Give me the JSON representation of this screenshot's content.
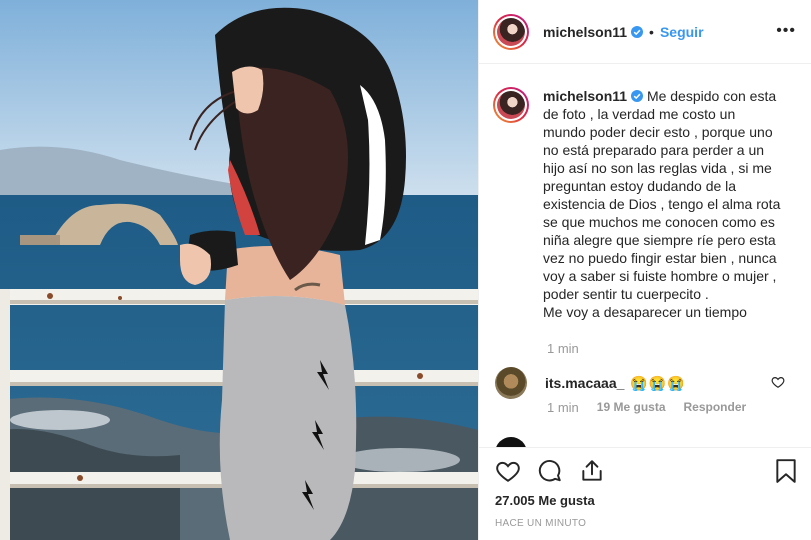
{
  "post": {
    "username": "michelson11",
    "follow_label": "Seguir",
    "more_label": "•••",
    "separator": "•"
  },
  "caption": {
    "username": "michelson11",
    "text_lines": [
      "Me despido con esta",
      "de foto , la verdad me costo un",
      "mundo poder decir esto , porque uno",
      "no está preparado para perder a un",
      "hijo así no son las reglas vida , si me",
      "preguntan estoy dudando de la",
      "existencia de Dios , tengo el alma rota",
      "se que muchos me conocen como es",
      "niña alegre que siempre ríe pero esta",
      "vez no puedo fingir estar bien , nunca",
      "voy a saber si fuiste hombre o mujer ,",
      "poder sentir tu cuerpecito .",
      "Me voy a desaparecer un tiempo"
    ],
    "time": "1 min"
  },
  "comment": {
    "username": "its.macaaa_",
    "text": "😭😭😭",
    "time": "1 min",
    "likes": "19 Me gusta",
    "reply_label": "Responder"
  },
  "footer": {
    "likes": "27.005 Me gusta",
    "time_ago": "HACE UN MINUTO"
  },
  "icons": {
    "like": "heart-icon",
    "comment": "comment-icon",
    "share": "share-icon",
    "save": "bookmark-icon"
  },
  "colors": {
    "follow": "#3897f0",
    "verified": "#3897f0",
    "muted": "#999999"
  }
}
